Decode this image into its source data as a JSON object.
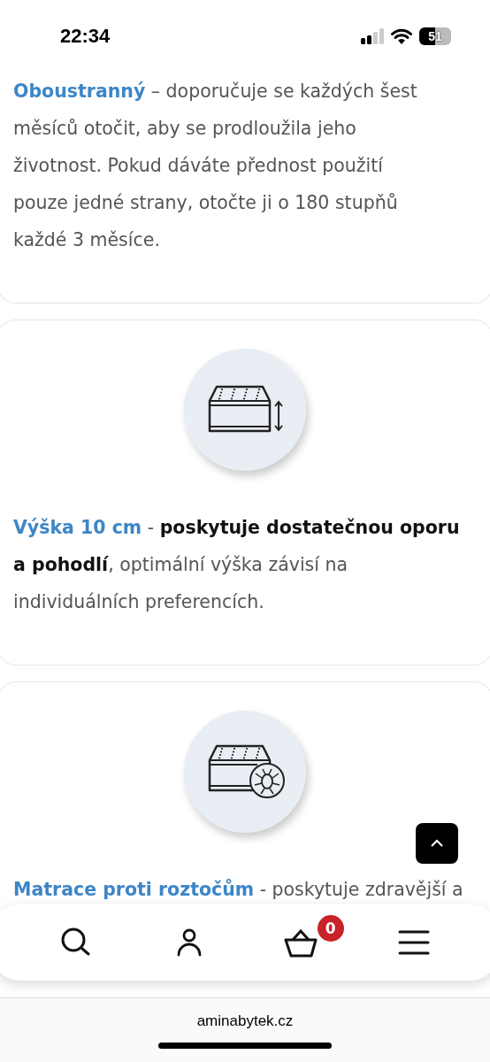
{
  "status_bar": {
    "time": "22:34",
    "battery": "51"
  },
  "cards": [
    {
      "kind": "plain",
      "term": "Oboustranný",
      "body": "– doporučuje se každých šest měsíců otočit, aby se prodloužila jeho životnost. Pokud dáváte přednost použití pouze jedné strany, otočte ji o 180 stupňů každé 3 měsíce."
    },
    {
      "kind": "height",
      "term": "Výška 10 cm",
      "body": "- **poskytuje dostatečnou oporu a pohodlí**, optimální výška závisí na individuálních preferencích."
    },
    {
      "kind": "mites",
      "term": "Matrace proti roztočům",
      "body": "- poskytuje zdravější a"
    }
  ],
  "bottom_nav": {
    "cart_count": "0"
  },
  "browser": {
    "url": "aminabytek.cz"
  }
}
